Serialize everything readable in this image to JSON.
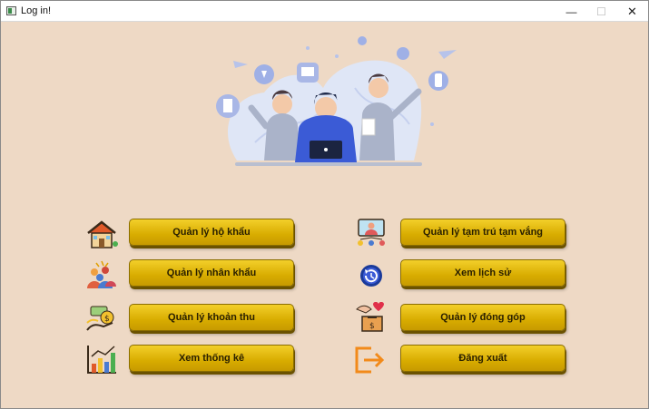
{
  "window": {
    "title": "Log in!",
    "minimize_glyph": "—",
    "maximize_glyph": "☐",
    "close_glyph": "✕"
  },
  "menu": {
    "left": [
      {
        "label": "Quản lý hộ khẩu",
        "icon": "house-icon"
      },
      {
        "label": "Quản lý nhân khẩu",
        "icon": "people-group-icon"
      },
      {
        "label": "Quản lý khoản thu",
        "icon": "money-hand-icon"
      },
      {
        "label": "Xem thống kê",
        "icon": "statistics-chart-icon"
      }
    ],
    "right": [
      {
        "label": "Quản lý tạm trú tạm vắng",
        "icon": "person-presentation-icon"
      },
      {
        "label": "Xem lịch sử",
        "icon": "history-icon"
      },
      {
        "label": "Quản lý đóng góp",
        "icon": "donation-box-icon"
      },
      {
        "label": "Đăng xuất",
        "icon": "logout-icon"
      }
    ]
  },
  "colors": {
    "background": "#eed9c5",
    "button": "#e0b800",
    "accent_blue": "#3b5bd6",
    "logout_orange": "#f28a1a"
  }
}
